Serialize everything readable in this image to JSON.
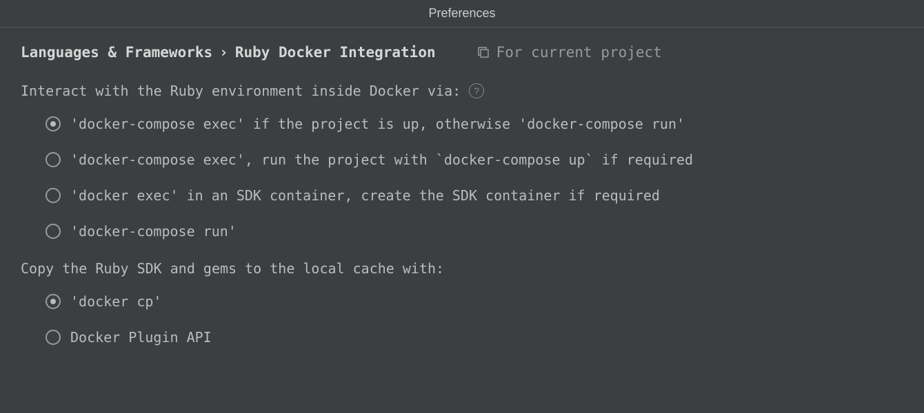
{
  "window": {
    "title": "Preferences"
  },
  "breadcrumb": {
    "part1": "Languages & Frameworks",
    "separator": "›",
    "part2": "Ruby Docker Integration"
  },
  "scope": {
    "label": "For current project"
  },
  "section1": {
    "label": "Interact with the Ruby environment inside Docker via:",
    "options": [
      "'docker-compose exec' if the project is up, otherwise 'docker-compose run'",
      "'docker-compose exec', run the project with `docker-compose up` if required",
      "'docker exec' in an SDK container, create the SDK container if required",
      "'docker-compose run'"
    ],
    "selected_index": 0
  },
  "section2": {
    "label": "Copy the Ruby SDK and gems to the local cache with:",
    "options": [
      "'docker cp'",
      "Docker Plugin API"
    ],
    "selected_index": 0
  }
}
